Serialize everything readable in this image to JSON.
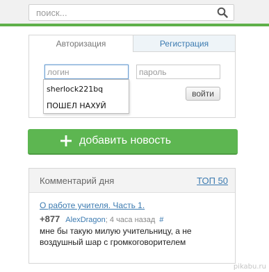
{
  "search": {
    "placeholder": "поиск..."
  },
  "auth": {
    "tabs": [
      {
        "label": "Авторизация",
        "active": true
      },
      {
        "label": "Регистрация",
        "active": false
      }
    ],
    "login_placeholder": "логин",
    "password_placeholder": "пароль",
    "submit_label": "войти",
    "autocomplete": [
      "sherlock221bq",
      "ПОШЕЛ НАХУЙ"
    ]
  },
  "add_news": {
    "label": "добавить новость",
    "icon": "plus-icon"
  },
  "comment_of_day": {
    "title": "Комментарий дня",
    "top_link": "ТОП 50",
    "post_title": "О работе учителя. Часть 1.",
    "rating": "+877",
    "author": "AlexDragon",
    "time": "; 4 часа назад",
    "hash": "#",
    "text": "мне бы такую милую учительницу, а не воздушный шар с громкоговорителем"
  },
  "watermark": "pikabu.ru",
  "colors": {
    "accent_green": "#5db651",
    "link_blue": "#3b7ab0"
  }
}
